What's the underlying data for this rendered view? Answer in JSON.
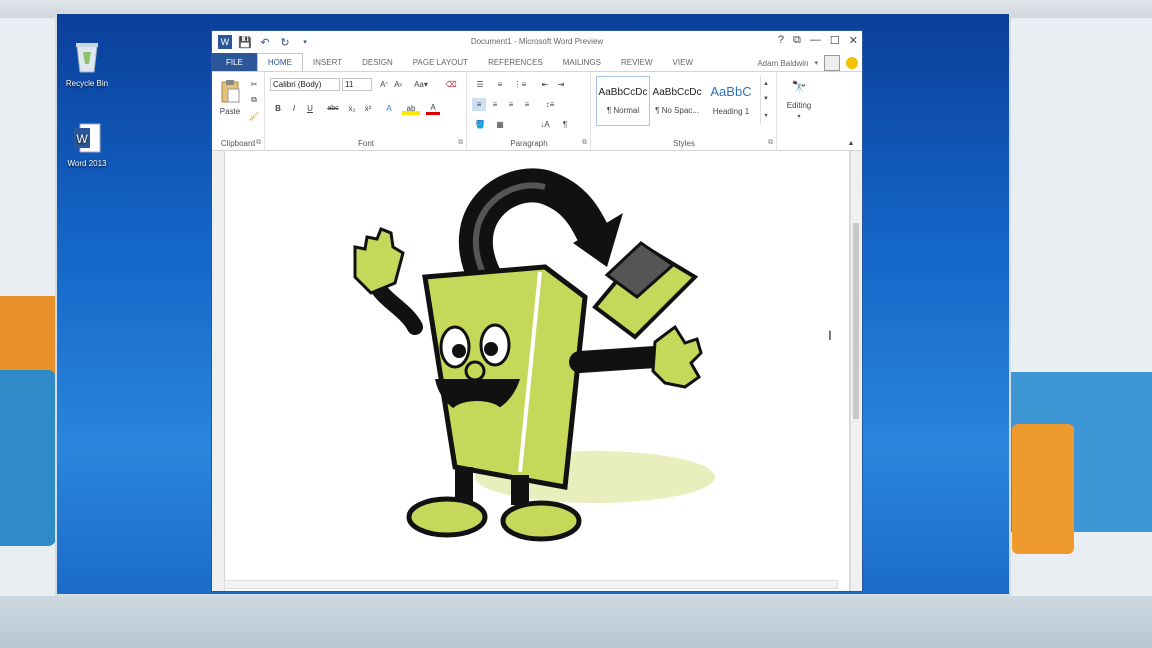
{
  "desktop": {
    "icons": [
      {
        "label": "Recycle Bin",
        "icon": "recycle-bin-icon"
      },
      {
        "label": "Word 2013",
        "icon": "word-icon"
      }
    ]
  },
  "word": {
    "title": "Document1 - Microsoft Word Preview",
    "window_controls": [
      "?",
      "⧉",
      "—",
      "☐",
      "✕"
    ],
    "tabs": [
      {
        "label": "FILE"
      },
      {
        "label": "HOME",
        "active": true
      },
      {
        "label": "INSERT"
      },
      {
        "label": "DESIGN"
      },
      {
        "label": "PAGE LAYOUT"
      },
      {
        "label": "REFERENCES"
      },
      {
        "label": "MAILINGS"
      },
      {
        "label": "REVIEW"
      },
      {
        "label": "VIEW"
      }
    ],
    "user_name": "Adam Baldwin",
    "ribbon": {
      "clipboard": {
        "label": "Clipboard",
        "paste_label": "Paste"
      },
      "font": {
        "label": "Font",
        "font_name": "Calibri (Body)",
        "font_size": "11",
        "buttons": [
          "B",
          "I",
          "U",
          "abc",
          "x₂",
          "x²",
          "A",
          "A"
        ]
      },
      "paragraph": {
        "label": "Paragraph"
      },
      "styles": {
        "label": "Styles",
        "items": [
          {
            "sample": "AaBbCcDc",
            "name": "¶ Normal"
          },
          {
            "sample": "AaBbCcDc",
            "name": "¶ No Spac..."
          },
          {
            "sample": "AaBbC",
            "name": "Heading 1"
          }
        ]
      },
      "editing": {
        "label": "Editing"
      }
    }
  },
  "colors": {
    "word_blue": "#2b579a",
    "mascot_green": "#c6d85a",
    "desktop_blue": "#1466c8"
  }
}
